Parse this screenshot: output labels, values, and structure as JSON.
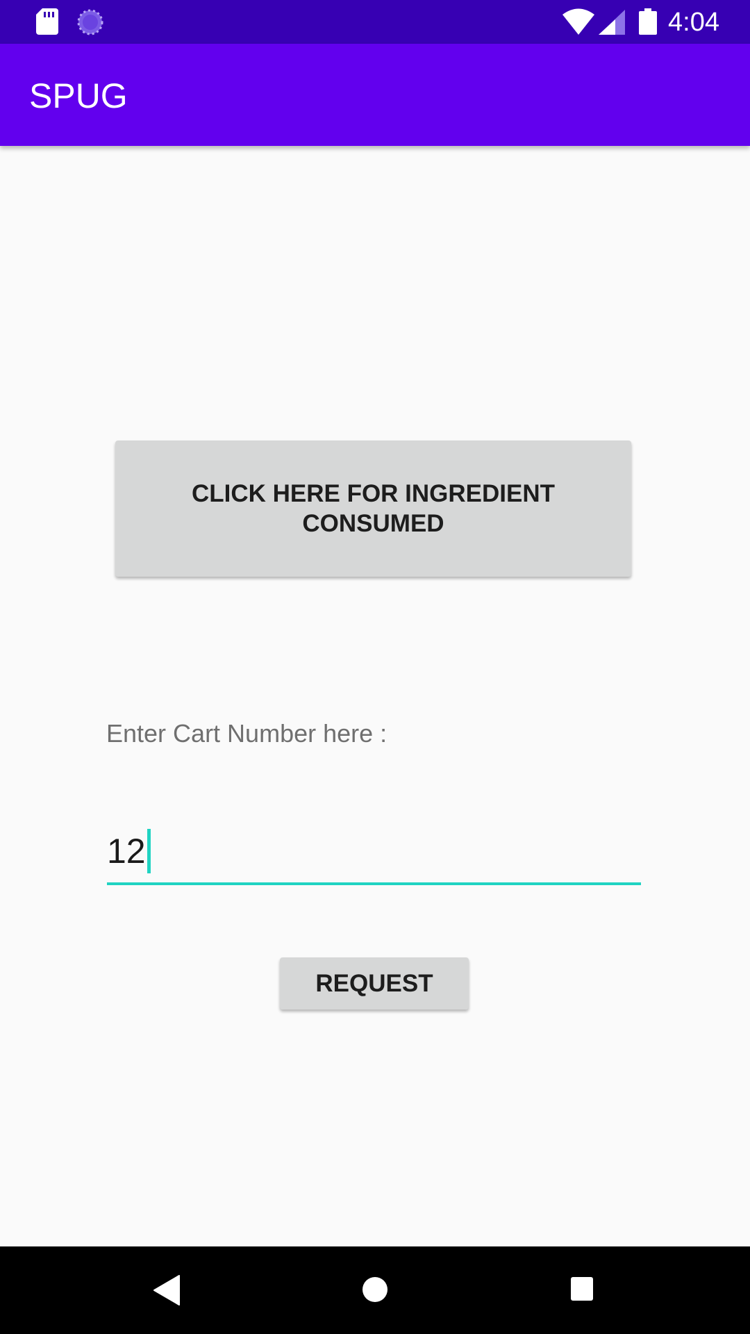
{
  "status_bar": {
    "time": "4:04",
    "icons": [
      "sd-card-icon",
      "sync-icon",
      "wifi-icon",
      "signal-icon",
      "battery-icon"
    ]
  },
  "app_bar": {
    "title": "SPUG"
  },
  "main": {
    "ingredient_button_label": "CLICK HERE FOR INGREDIENT CONSUMED",
    "cart_label": "Enter Cart Number here :",
    "cart_input_value": "12",
    "request_button_label": "REQUEST"
  },
  "nav_bar": {
    "icons": [
      "back-icon",
      "home-icon",
      "recents-icon"
    ]
  },
  "colors": {
    "status_bar": "#3700b3",
    "app_bar": "#6200ee",
    "accent": "#20d3c2",
    "button": "#d6d7d7",
    "background": "#fafafa"
  }
}
